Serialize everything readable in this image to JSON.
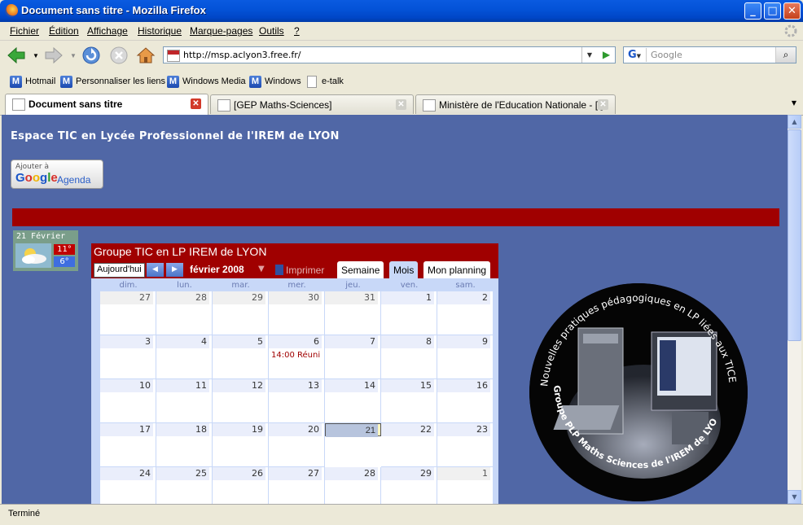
{
  "window": {
    "title": "Document sans titre - Mozilla Firefox"
  },
  "menu": [
    "Fichier",
    "Édition",
    "Affichage",
    "Historique",
    "Marque-pages",
    "Outils",
    "?"
  ],
  "nav": {
    "url": "http://msp.aclyon3.free.fr/",
    "search_placeholder": "Google"
  },
  "bookmarks": [
    "Hotmail",
    "Personnaliser les liens",
    "Windows Media",
    "Windows",
    "e-talk"
  ],
  "tabs": [
    {
      "label": "Document sans titre",
      "active": true
    },
    {
      "label": "[GEP Maths-Sciences]",
      "active": false
    },
    {
      "label": "Ministère de l'Education Nationale - [.]",
      "active": false
    }
  ],
  "status": "Terminé",
  "page": {
    "title": "Espace TIC en Lycée Professionnel de l'IREM de LYON",
    "badge": {
      "small": "Ajouter à",
      "google": "Google",
      "agenda": "Agenda"
    },
    "weather": {
      "date": "21 Février",
      "high": "11°",
      "low": "6°"
    },
    "calendar": {
      "title": "Groupe TIC en LP IREM de LYON",
      "today_label": "Aujourd'hui",
      "month_label": "février 2008",
      "print_label": "Imprimer",
      "views": [
        "Semaine",
        "Mois",
        "Mon planning"
      ],
      "weekdays": [
        "dim.",
        "lun.",
        "mar.",
        "mer.",
        "jeu.",
        "ven.",
        "sam."
      ],
      "weeks": [
        [
          "27",
          "28",
          "29",
          "30",
          "31",
          "1",
          "2"
        ],
        [
          "3",
          "4",
          "5",
          "6",
          "7",
          "8",
          "9"
        ],
        [
          "10",
          "11",
          "12",
          "13",
          "14",
          "15",
          "16"
        ],
        [
          "17",
          "18",
          "19",
          "20",
          "21",
          "22",
          "23"
        ],
        [
          "24",
          "25",
          "26",
          "27",
          "28",
          "29",
          "1"
        ]
      ],
      "event": {
        "week": 1,
        "day": 3,
        "text": "14:00 Réuni"
      },
      "today": {
        "week": 3,
        "day": 4
      }
    },
    "logo": {
      "top_text": "Nouvelles pratiques pédagogiques en LP liées aux TICE",
      "bottom_text": "Groupe PLP Maths Sciences de l'IREM de LYON"
    }
  }
}
